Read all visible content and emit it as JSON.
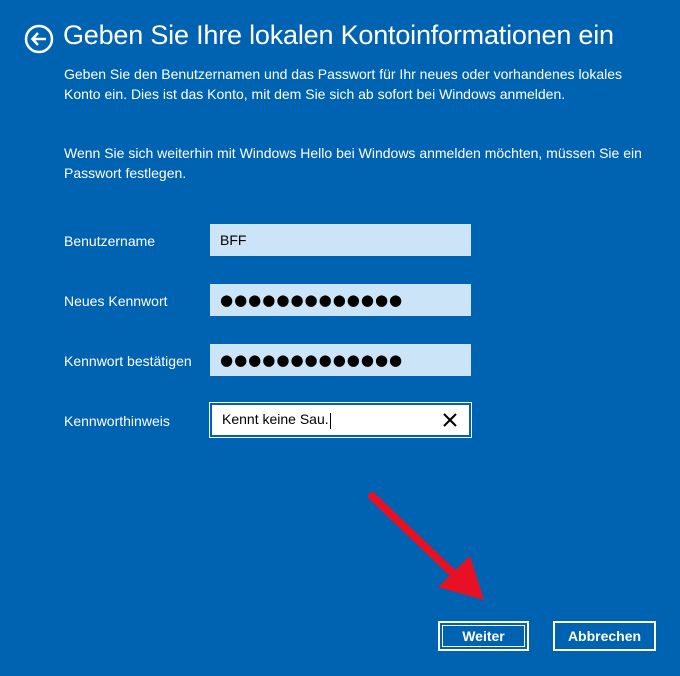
{
  "header": {
    "back_icon": "arrow-left-circle-icon",
    "title": "Geben Sie Ihre lokalen Kontoinformationen ein"
  },
  "intro": {
    "paragraph1": "Geben Sie den Benutzernamen und das Passwort für Ihr neues oder vorhandenes lokales Konto ein. Dies ist das Konto, mit dem Sie sich ab sofort bei Windows anmelden.",
    "paragraph2": "Wenn Sie sich weiterhin mit Windows Hello bei Windows anmelden möchten, müssen Sie ein Passwort festlegen."
  },
  "form": {
    "username_label": "Benutzername",
    "username_value": "BFF",
    "password_label": "Neues Kennwort",
    "password_value": "●●●●●●●●●●●●●",
    "confirm_label": "Kennwort bestätigen",
    "confirm_value": "●●●●●●●●●●●●●",
    "hint_label": "Kennworthinweis",
    "hint_value": "Kennt keine Sau."
  },
  "buttons": {
    "next": "Weiter",
    "cancel": "Abbrechen"
  },
  "colors": {
    "background": "#0063b1",
    "field_background": "#cce4f7",
    "annotation_arrow": "#e81123"
  }
}
